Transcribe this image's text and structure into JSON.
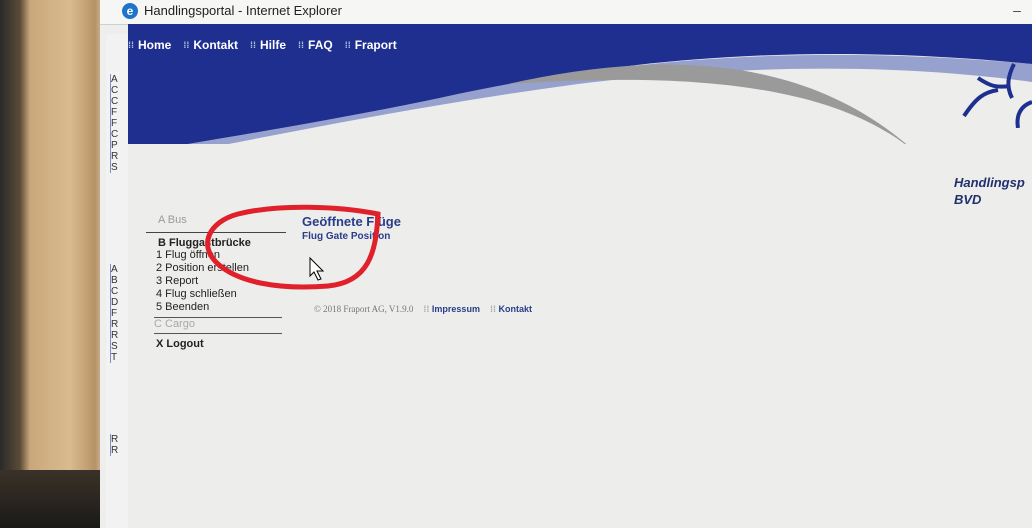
{
  "window": {
    "title": "Handlingsportal - Internet Explorer"
  },
  "nav": [
    {
      "label": "Home"
    },
    {
      "label": "Kontakt"
    },
    {
      "label": "Hilfe"
    },
    {
      "label": "FAQ"
    },
    {
      "label": "Fraport"
    }
  ],
  "brand": {
    "line1": "Handlingsp",
    "line2": "BVD"
  },
  "left_strip_letters": [
    "A",
    "C",
    "C",
    "F",
    "F",
    "C",
    "P",
    "R",
    "S",
    "A",
    "B",
    "C",
    "D",
    "F",
    "R",
    "R",
    "S",
    "T",
    "R",
    "R"
  ],
  "menu": {
    "section_a": "A Bus",
    "section_b": "B Fluggastbrücke",
    "items": [
      {
        "label": "1 Flug öffnen"
      },
      {
        "label": "2 Position erstellen"
      },
      {
        "label": "3 Report"
      },
      {
        "label": "4 Flug schließen"
      },
      {
        "label": "5 Beenden"
      }
    ],
    "section_c": "C Cargo",
    "logout": "X Logout"
  },
  "content": {
    "title": "Geöffnete Flüge",
    "subtitle": "Flug Gate Position"
  },
  "footer": {
    "copyright": "© 2018 Fraport AG, V1.9.0",
    "impressum": "Impressum",
    "kontakt": "Kontakt"
  },
  "colors": {
    "header_blue": "#1f2f8f",
    "text_blue": "#2a3d8a",
    "annotation_red": "#e0202a"
  }
}
